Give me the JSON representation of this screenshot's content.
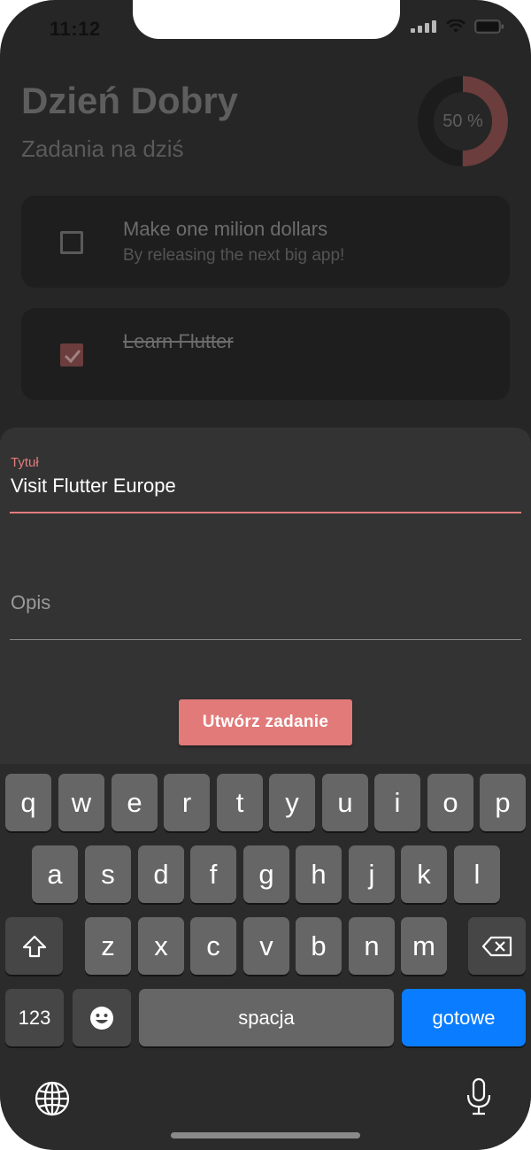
{
  "status_bar": {
    "time": "11:12"
  },
  "header": {
    "greeting": "Dzień Dobry",
    "subtitle": "Zadania na dziś",
    "progress_label": "50 %",
    "progress_value": 0.5
  },
  "tasks": [
    {
      "title": "Make one milion dollars",
      "description": "By releasing the next big app!",
      "done": false
    },
    {
      "title": "Learn Flutter",
      "description": "",
      "done": true
    }
  ],
  "form": {
    "title_label": "Tytuł",
    "title_value": "Visit Flutter Europe",
    "description_placeholder": "Opis",
    "submit_label": "Utwórz zadanie"
  },
  "keyboard": {
    "row1": [
      "q",
      "w",
      "e",
      "r",
      "t",
      "y",
      "u",
      "i",
      "o",
      "p"
    ],
    "row2": [
      "a",
      "s",
      "d",
      "f",
      "g",
      "h",
      "j",
      "k",
      "l"
    ],
    "row3": [
      "z",
      "x",
      "c",
      "v",
      "b",
      "n",
      "m"
    ],
    "numbers_label": "123",
    "space_label": "spacja",
    "return_label": "gotowe"
  },
  "colors": {
    "accent": "#e17a79",
    "background": "#262626",
    "card": "#1e1e1e",
    "sheet": "#333333",
    "keyboard_blue": "#0a7cff"
  }
}
